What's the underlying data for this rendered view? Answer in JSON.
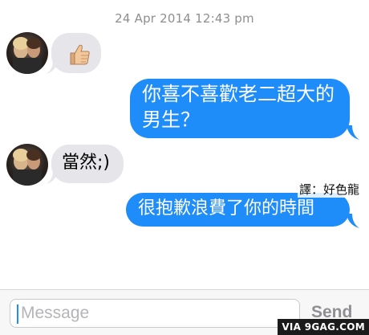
{
  "conversation": {
    "timestamp": "24 Apr 2014 12:43 pm",
    "messages": [
      {
        "from": "them",
        "kind": "emoji",
        "icon": "thumbs-up-icon"
      },
      {
        "from": "me",
        "text": "你喜不喜歡老二超大的\n男生？"
      },
      {
        "from": "them",
        "text": "當然;)"
      },
      {
        "from": "me",
        "text": "很抱歉浪費了你的時間"
      }
    ],
    "translator_note": "譯：好色龍"
  },
  "composer": {
    "placeholder": "Message",
    "send_label": "Send"
  },
  "watermark": "VIA 9GAG.COM",
  "colors": {
    "outgoing_bubble": "#1e8cf9",
    "incoming_bubble": "#e5e5ea",
    "timestamp_text": "#8e8e93"
  }
}
